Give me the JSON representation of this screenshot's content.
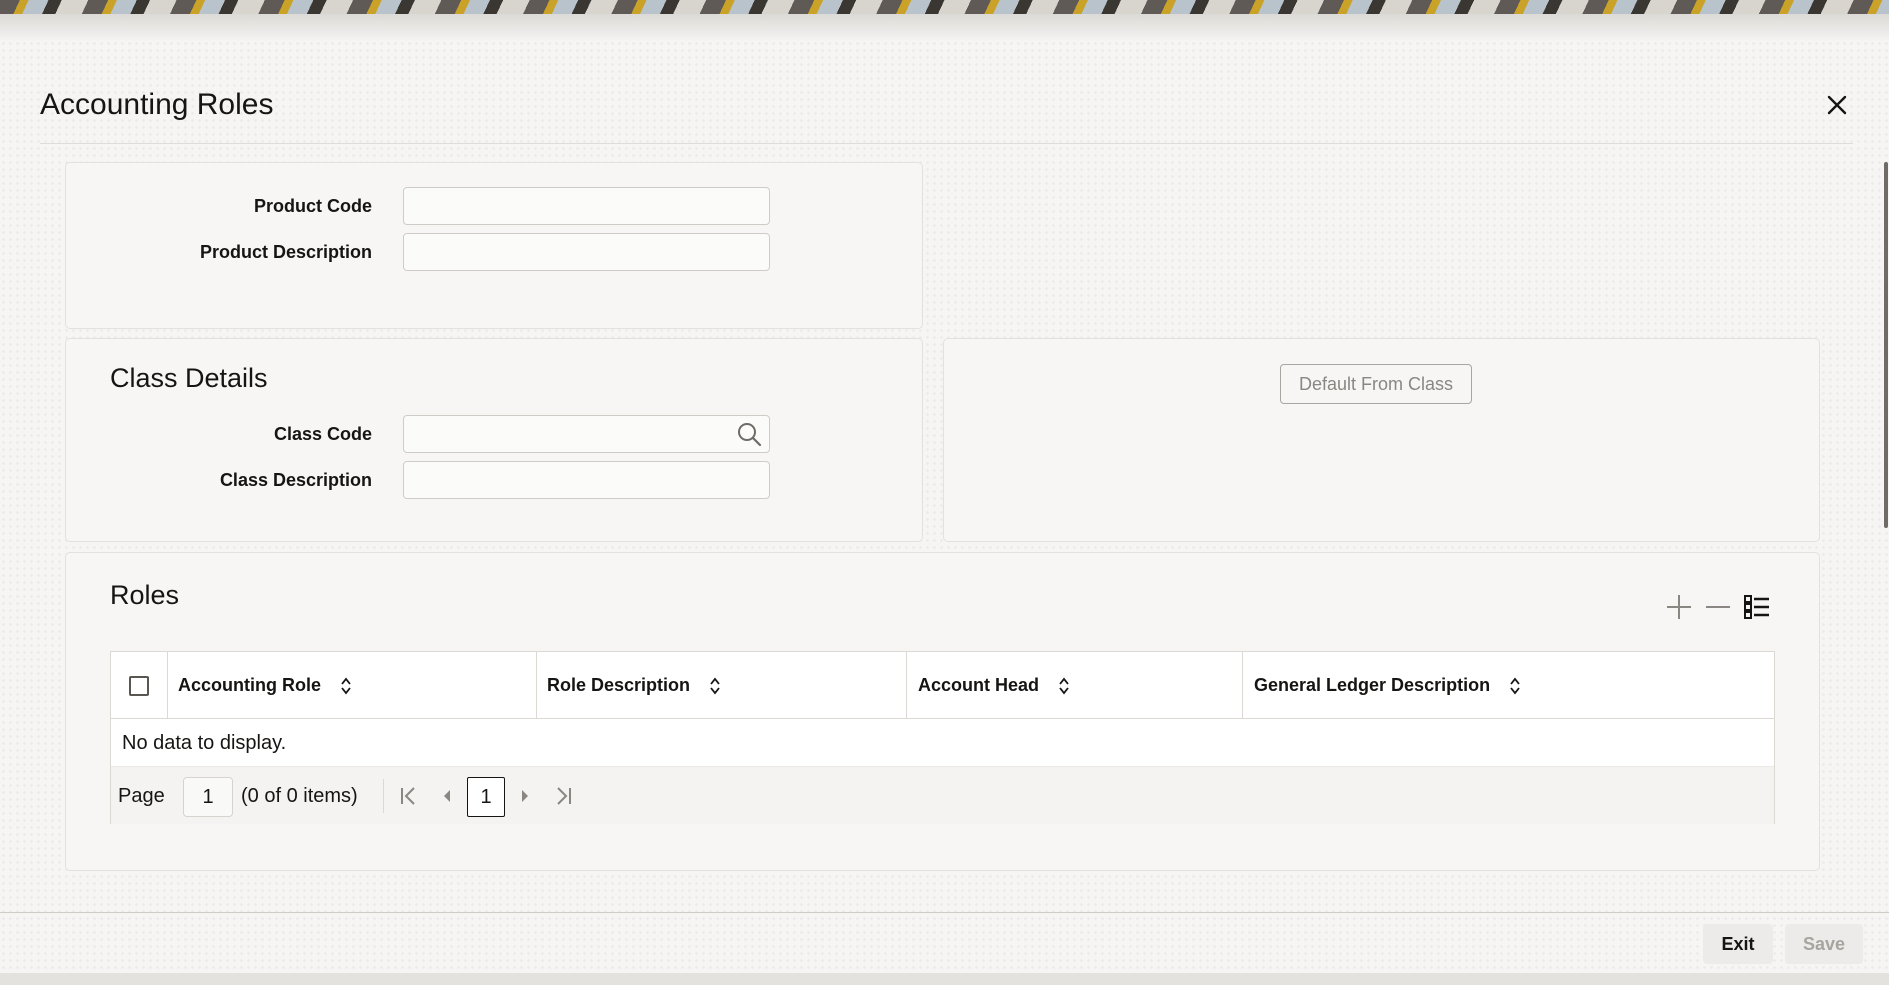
{
  "window": {
    "title": "Accounting Roles",
    "close_icon": "close-icon"
  },
  "product": {
    "code_label": "Product Code",
    "code_value": "",
    "description_label": "Product Description",
    "description_value": ""
  },
  "class_details": {
    "title": "Class Details",
    "code_label": "Class Code",
    "code_value": "",
    "description_label": "Class Description",
    "description_value": "",
    "search_icon": "search-icon"
  },
  "actions": {
    "default_from_class_label": "Default From Class"
  },
  "roles": {
    "title": "Roles",
    "toolbar": {
      "add_icon": "plus-icon",
      "remove_icon": "minus-icon",
      "single_record_icon": "list-view-icon"
    },
    "columns": [
      {
        "label": "Accounting Role"
      },
      {
        "label": "Role Description"
      },
      {
        "label": "Account Head"
      },
      {
        "label": "General Ledger Description"
      }
    ],
    "rows": [],
    "empty_message": "No data to display.",
    "pager": {
      "page_label": "Page",
      "page_input": "1",
      "summary": "(0 of 0 items)",
      "current_page": "1"
    }
  },
  "footer": {
    "exit_label": "Exit",
    "save_label": "Save"
  },
  "colors": {
    "text": "#161513",
    "disabled_text": "#8a8682",
    "panel_bg": "#f7f6f5",
    "border": "#dcd9d5"
  }
}
